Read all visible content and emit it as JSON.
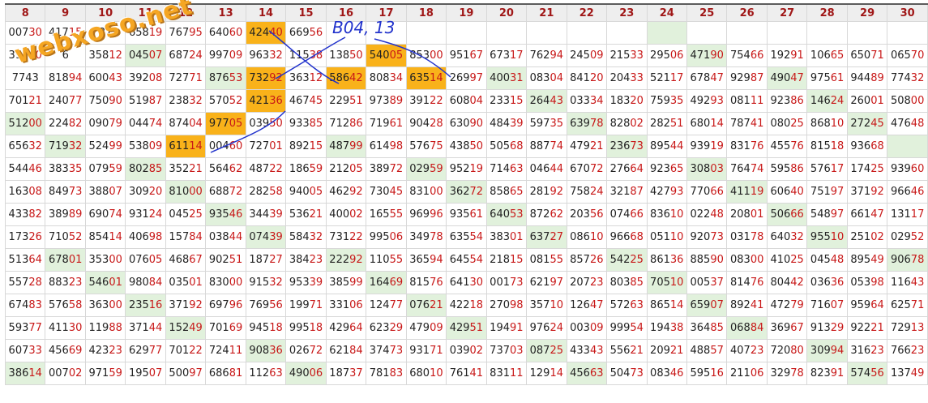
{
  "watermark": "webxoso.net",
  "annotation": "B04, 13",
  "colors": {
    "highlight_orange": "#f9b21a",
    "highlight_green": "#e1f1dc",
    "header_text": "#a01818",
    "annotation_blue": "#2233cc"
  },
  "columns": [
    "8",
    "9",
    "10",
    "11",
    "12",
    "13",
    "14",
    "15",
    "16",
    "17",
    "18",
    "19",
    "20",
    "21",
    "22",
    "23",
    "24",
    "25",
    "26",
    "27",
    "28",
    "29",
    "30"
  ],
  "rows": [
    [
      "00730",
      "41715",
      "37",
      "65819",
      "76795",
      "64060",
      "42440",
      "66956",
      "",
      "",
      "",
      "",
      "",
      "",
      "",
      "",
      "",
      "",
      "",
      "",
      "",
      "",
      ""
    ],
    [
      "39000",
      "6",
      "35812",
      "04507",
      "68724",
      "99709",
      "96332",
      "11538",
      "13850",
      "54005",
      "85300",
      "95167",
      "67317",
      "76294",
      "24509",
      "21533",
      "29506",
      "47190",
      "75466",
      "19291",
      "10665",
      "65071",
      "06570"
    ],
    [
      "7743",
      "81894",
      "60043",
      "39208",
      "72771",
      "87653",
      "73292",
      "36312",
      "58642",
      "80834",
      "63514",
      "26997",
      "40031",
      "08304",
      "84120",
      "20433",
      "52117",
      "67847",
      "92987",
      "49047",
      "97561",
      "94489",
      "77432"
    ],
    [
      "70121",
      "24077",
      "75090",
      "51987",
      "23832",
      "57052",
      "42136",
      "46745",
      "22951",
      "97389",
      "39122",
      "60804",
      "23315",
      "26443",
      "03334",
      "18320",
      "75935",
      "49293",
      "08111",
      "92386",
      "14624",
      "26001",
      "50800"
    ],
    [
      "51200",
      "22482",
      "09079",
      "04474",
      "87404",
      "97705",
      "03950",
      "93385",
      "71286",
      "71961",
      "90428",
      "63090",
      "48439",
      "59735",
      "63978",
      "82802",
      "28251",
      "68014",
      "78741",
      "08025",
      "86810",
      "27245",
      "47648"
    ],
    [
      "65632",
      "71932",
      "52499",
      "53809",
      "61114",
      "00460",
      "72701",
      "89215",
      "48799",
      "61498",
      "57675",
      "43850",
      "50568",
      "88774",
      "47921",
      "23673",
      "89544",
      "93919",
      "83176",
      "45576",
      "81518",
      "93668",
      ""
    ],
    [
      "54446",
      "38335",
      "07959",
      "80285",
      "35221",
      "56462",
      "48722",
      "18659",
      "21205",
      "38972",
      "02959",
      "95219",
      "71463",
      "04644",
      "67072",
      "27664",
      "92365",
      "30803",
      "76474",
      "59586",
      "57617",
      "17425",
      "93960"
    ],
    [
      "16308",
      "84973",
      "38807",
      "30920",
      "81000",
      "68872",
      "28258",
      "94005",
      "46292",
      "73045",
      "83100",
      "36272",
      "85865",
      "28192",
      "75824",
      "32187",
      "42793",
      "77066",
      "41119",
      "60640",
      "75197",
      "37192",
      "96646"
    ],
    [
      "43382",
      "38989",
      "69074",
      "93124",
      "04525",
      "93546",
      "34439",
      "53621",
      "40002",
      "16555",
      "96996",
      "93561",
      "64053",
      "87262",
      "20356",
      "07466",
      "83610",
      "02248",
      "20801",
      "50666",
      "54897",
      "66147",
      "13117"
    ],
    [
      "17326",
      "71052",
      "85414",
      "40698",
      "15784",
      "03844",
      "07439",
      "58432",
      "73122",
      "99506",
      "34978",
      "63554",
      "38301",
      "63727",
      "08610",
      "96668",
      "05110",
      "92073",
      "03178",
      "64032",
      "95510",
      "25102",
      "02952"
    ],
    [
      "51364",
      "67801",
      "35300",
      "07605",
      "46867",
      "90251",
      "18727",
      "38423",
      "22292",
      "11055",
      "36594",
      "64554",
      "21815",
      "08155",
      "85726",
      "54225",
      "86136",
      "88590",
      "08300",
      "41025",
      "04548",
      "89549",
      "90678"
    ],
    [
      "55728",
      "88323",
      "54601",
      "98084",
      "03501",
      "83000",
      "91532",
      "95339",
      "38599",
      "16469",
      "81576",
      "64130",
      "00173",
      "62197",
      "20723",
      "80385",
      "70510",
      "00537",
      "81476",
      "80442",
      "03636",
      "05398",
      "11643"
    ],
    [
      "67483",
      "57658",
      "36300",
      "23516",
      "37192",
      "69796",
      "76956",
      "19971",
      "33106",
      "12477",
      "07621",
      "42218",
      "27098",
      "35710",
      "12647",
      "57263",
      "86514",
      "65907",
      "89241",
      "47279",
      "71607",
      "95964",
      "62571"
    ],
    [
      "59377",
      "41130",
      "11988",
      "37144",
      "15249",
      "70169",
      "94518",
      "99518",
      "42964",
      "62329",
      "47909",
      "42951",
      "19491",
      "97624",
      "00309",
      "99954",
      "19438",
      "36485",
      "06884",
      "36967",
      "91329",
      "92221",
      "72913"
    ],
    [
      "60733",
      "45669",
      "42323",
      "62977",
      "70122",
      "72411",
      "90836",
      "02672",
      "62184",
      "37473",
      "93171",
      "03902",
      "73703",
      "08725",
      "43343",
      "55621",
      "20921",
      "48857",
      "40723",
      "72080",
      "30994",
      "31623",
      "76623"
    ],
    [
      "38614",
      "00702",
      "97159",
      "19507",
      "50097",
      "68681",
      "11263",
      "49006",
      "18737",
      "78183",
      "68010",
      "76141",
      "83111",
      "12914",
      "45663",
      "50473",
      "08346",
      "59516",
      "21106",
      "32978",
      "82391",
      "57456",
      "13749"
    ]
  ]
}
